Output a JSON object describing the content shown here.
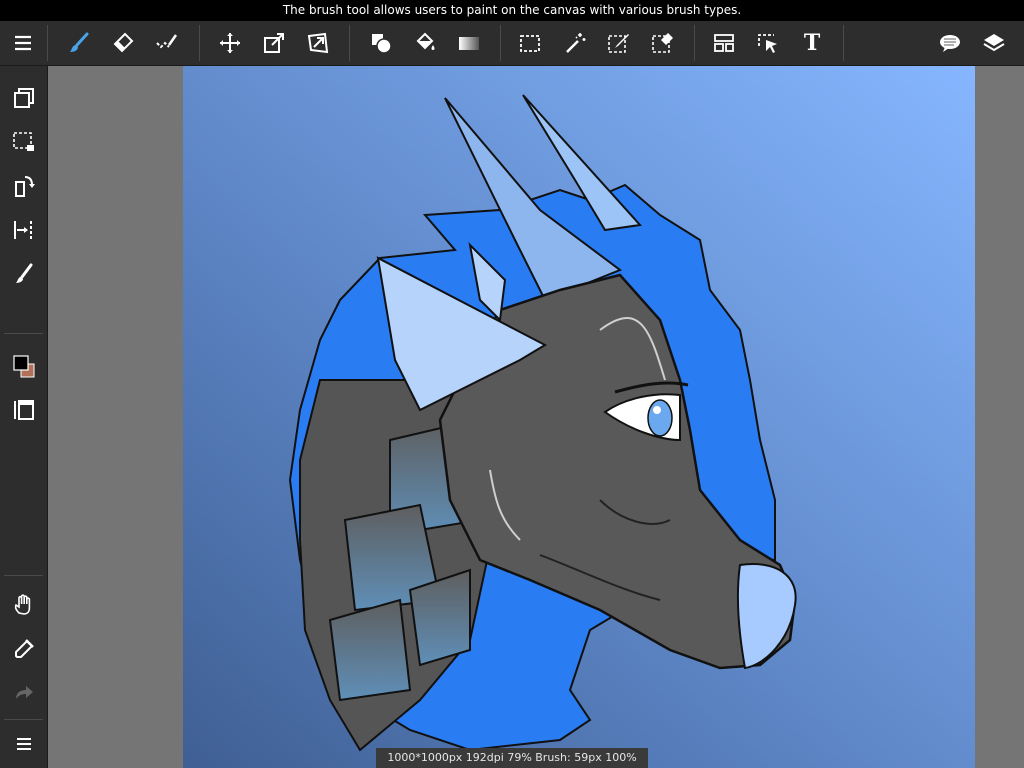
{
  "tooltip": {
    "text": "The brush tool allows users to paint on the canvas with various brush types."
  },
  "status": {
    "text": "1000*1000px 192dpi 79% Brush: 59px 100%"
  },
  "colors": {
    "toolbar_bg": "#2d2d2d",
    "active_icon": "#4aa3e8",
    "icon": "#ffffff",
    "primary_color": "#000000",
    "secondary_color": "#b0705a"
  },
  "toolbar": {
    "text_tool_label": "T"
  },
  "icons": [
    "menu-icon",
    "brush-icon",
    "eraser-icon",
    "smudge-icon",
    "move-icon",
    "transform-icon",
    "distort-icon",
    "fill-shape-icon",
    "bucket-icon",
    "gradient-icon",
    "select-rect-icon",
    "magic-wand-icon",
    "select-pen-icon",
    "select-eraser-icon",
    "frame-divider-icon",
    "operation-icon",
    "text-icon",
    "speech-bubble-icon",
    "layers-icon",
    "copy-icon",
    "select-clear-icon",
    "rotate-icon",
    "ruler-icon",
    "brush-tool-icon",
    "color-swatch-icon",
    "canvas-icon",
    "hand-icon",
    "eyedropper-icon",
    "redo-icon",
    "menu-bottom-icon"
  ]
}
